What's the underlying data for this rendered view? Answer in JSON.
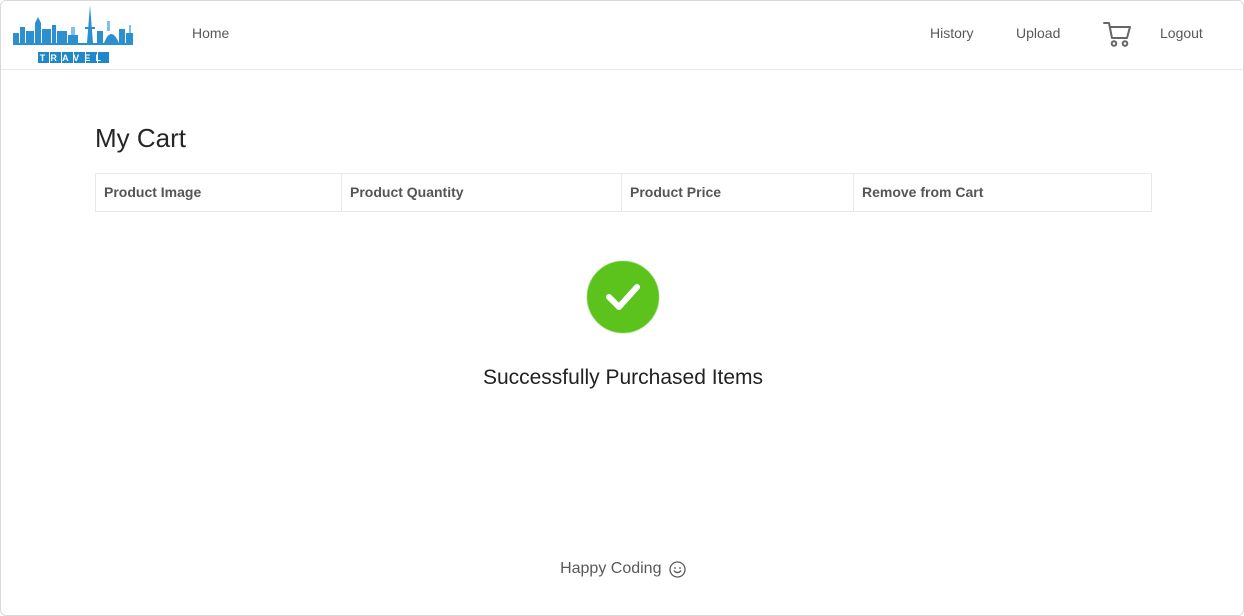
{
  "header": {
    "logo_text": "TRAVEL",
    "nav": {
      "home": "Home",
      "history": "History",
      "upload": "Upload",
      "cart_icon": "shopping-cart-icon",
      "logout": "Logout"
    }
  },
  "main": {
    "title": "My Cart",
    "table_headers": [
      "Product Image",
      "Product Quantity",
      "Product Price",
      "Remove from Cart"
    ],
    "success_icon": "check-circle-icon",
    "success_message": "Successfully Purchased Items"
  },
  "footer": {
    "text": "Happy Coding",
    "icon": "smile-icon"
  },
  "colors": {
    "success_green": "#52c41a",
    "logo_blue": "#1e88c8"
  }
}
